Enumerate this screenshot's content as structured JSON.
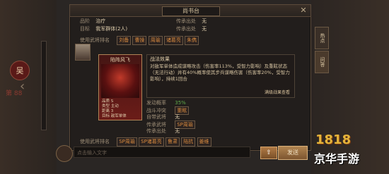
{
  "header": {
    "title": "尚书台",
    "close": "✕"
  },
  "left": {
    "badge": "吴",
    "counter": "第 88"
  },
  "top_rows": [
    {
      "label": "品阶",
      "value": "治疗",
      "extra_label": "传承出处",
      "extra_value": "无"
    },
    {
      "label": "目标",
      "value": "我军群体(2人)",
      "extra_label": "传承出处",
      "extra_value": "无"
    }
  ],
  "generals_row": {
    "label": "使用武将排名",
    "names": [
      "刘备",
      "曹操",
      "周瑜",
      "诸葛亮",
      "朱儁"
    ]
  },
  "card": {
    "title": "陷阵风飞",
    "level_label": "品质",
    "level_value": "S",
    "type_label": "类型",
    "type_value": "主动",
    "range_label": "距离",
    "range_value": "3",
    "target_label": "目标",
    "target_value": "敌军单体"
  },
  "desc": {
    "title": "战法效果",
    "text": "对敌军单体造成谋略攻击（伤害率113%，受智力影响）及重眩状态（无法行动）并有40%概率使其步兵谋略伤害（伤害率20%，受智力影响），持续1回合",
    "link": "满级战果查看"
  },
  "stats": [
    {
      "k": "发动概率",
      "v": "35%",
      "green": true
    },
    {
      "k": "战斗冲突",
      "v": "重眩",
      "tag": true
    },
    {
      "k": "自带武将",
      "v": "无"
    },
    {
      "k": "传承武将",
      "v": "SP周瑜",
      "tag": true
    },
    {
      "k": "传承出处",
      "v": "无"
    }
  ],
  "bottom_generals": {
    "label": "使用武将排名",
    "names": [
      "SP周瑜",
      "SP诸葛亮",
      "鲁肃",
      "陆抗",
      "姜维"
    ]
  },
  "side_tabs": [
    "热点",
    "问答"
  ],
  "chat": {
    "placeholder": "点击输入文字",
    "send": "发送",
    "up": "⇧",
    "avatar_label": "客服"
  },
  "watermark": {
    "number": "1818",
    "text": "京华手游"
  }
}
